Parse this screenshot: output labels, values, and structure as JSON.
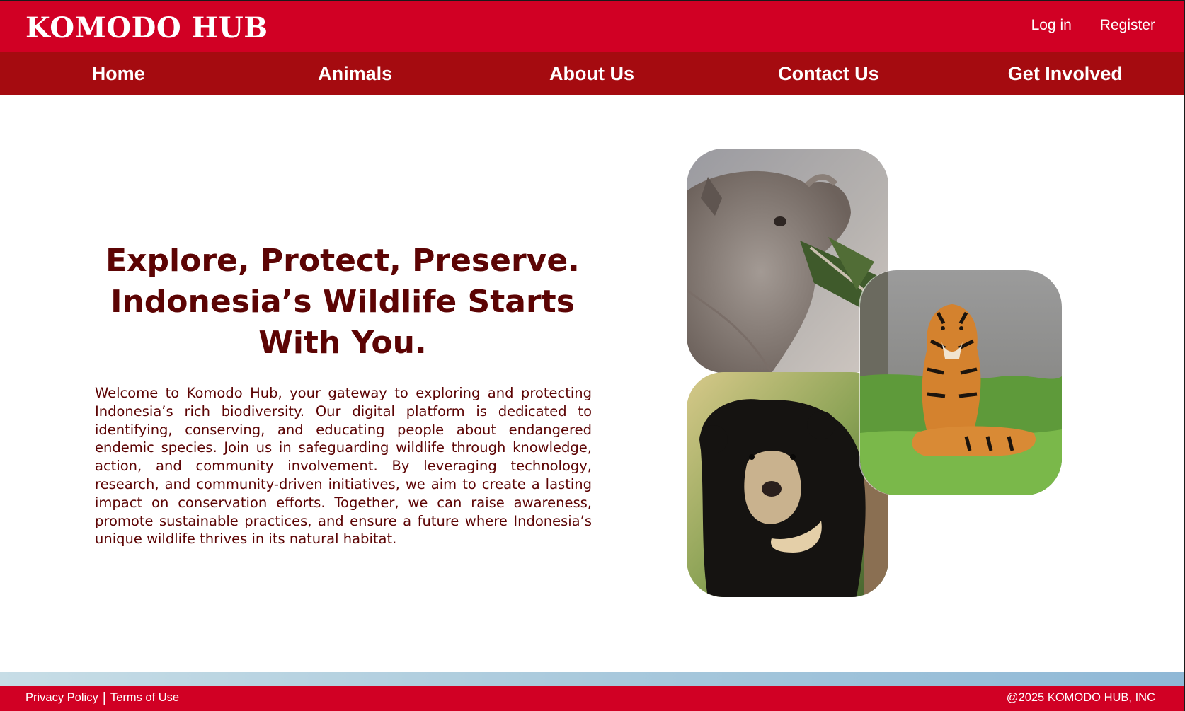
{
  "header": {
    "logo": "KOMODO HUB",
    "login_label": "Log in",
    "register_label": "Register"
  },
  "nav": {
    "items": [
      {
        "label": "Home"
      },
      {
        "label": "Animals"
      },
      {
        "label": "About Us"
      },
      {
        "label": "Contact Us"
      },
      {
        "label": "Get Involved"
      }
    ]
  },
  "hero": {
    "title_line1": "Explore, Protect, Preserve.",
    "title_line2": "Indonesia’s Wildlife Starts With You.",
    "description": "Welcome to Komodo Hub, your gateway to exploring and protecting Indonesia’s rich biodiversity. Our digital platform is dedicated to identifying, conserving, and educating people about endangered endemic species. Join us in safeguarding wildlife through knowledge, action, and community involvement. By leveraging technology, research, and community-driven initiatives, we aim to create a lasting impact on conservation efforts. Together, we can raise awareness, promote sustainable practices, and ensure a future where Indonesia’s unique wildlife thrives in its natural habitat."
  },
  "gallery": {
    "images": [
      {
        "subject": "rhino",
        "icon": "rhino-photo"
      },
      {
        "subject": "sun bear",
        "icon": "bear-photo"
      },
      {
        "subject": "tiger",
        "icon": "tiger-photo"
      }
    ]
  },
  "footer": {
    "privacy_label": "Privacy Policy",
    "separator": "|",
    "terms_label": "Terms of Use",
    "copyright": "@2025 KOMODO HUB, INC"
  },
  "colors": {
    "brand_red": "#d10024",
    "nav_red": "#a50b10",
    "text_maroon": "#5c0404"
  }
}
